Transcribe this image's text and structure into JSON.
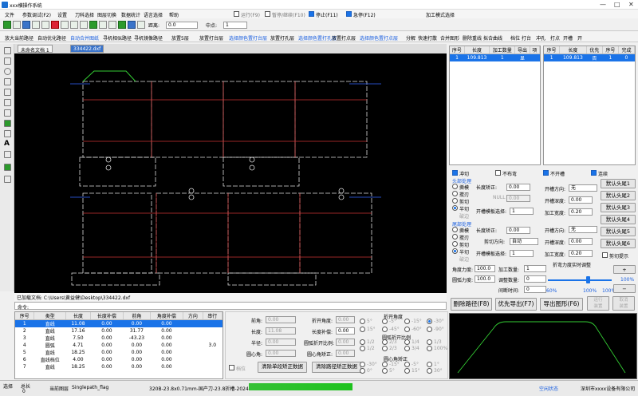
{
  "title": "xxx横操作系统",
  "menus": [
    "文件",
    "参数调试(F2)",
    "设置",
    "刀科选择",
    "图层切换",
    "数据统计",
    "语言选择",
    "帮助"
  ],
  "run_controls": {
    "run": "运行(F9)",
    "pause": "暂停/继续(F10)",
    "stop": "停止(F11)",
    "estop": "急停(F12)"
  },
  "mode_select": "加工模式选择",
  "toolbar": {
    "spacing_label": "距离:",
    "spacing_value": "0.0",
    "midpoint_label": "中点:",
    "midpoint_value": "1"
  },
  "toolbar2": [
    {
      "t": "放大当前路径",
      "b": false
    },
    {
      "t": "自动优化路径",
      "b": false
    },
    {
      "t": "自动合并图纸",
      "b": true
    },
    {
      "t": "寻机相似路径",
      "b": false
    },
    {
      "t": "寻机镜像路径",
      "b": false
    },
    {
      "t": "放置5层",
      "b": false
    },
    {
      "t": "放置打台层",
      "b": false
    },
    {
      "t": "选择颜色置打台层",
      "b": true
    },
    {
      "t": "放置打孔层",
      "b": false
    },
    {
      "t": "选择颜色置打孔层",
      "b": true
    },
    {
      "t": "放置打点层",
      "b": false
    },
    {
      "t": "选择颜色置打点层",
      "b": true
    },
    {
      "t": "分解",
      "b": false
    },
    {
      "t": "快速打散",
      "b": false
    },
    {
      "t": "合并图形",
      "b": false
    },
    {
      "t": "删除重线",
      "b": false
    },
    {
      "t": "拟合曲线",
      "b": false
    },
    {
      "t": "档位",
      "b": false
    },
    {
      "t": "打台",
      "b": false
    },
    {
      "t": "冲孔",
      "b": false
    },
    {
      "t": "打点",
      "b": false
    },
    {
      "t": "开槽",
      "b": false
    },
    {
      "t": "开",
      "b": false
    }
  ],
  "doc_tabs": [
    "未命名文档 1",
    "334422.dxf"
  ],
  "loaded_file": "已加载文档: C:\\Users\\黄益健\\Desktop\\334422.dxf",
  "command_label": "命令:",
  "table1": {
    "headers": [
      "序号",
      "长度",
      "加工数量",
      "导出",
      "项"
    ],
    "rows": [
      [
        "1",
        "109.813",
        "1",
        "显",
        ""
      ]
    ]
  },
  "table2": {
    "headers": [
      "序号",
      "长度",
      "优先",
      "序号",
      "完成"
    ],
    "rows": [
      [
        "1",
        "109.813",
        "否",
        "1",
        "0"
      ]
    ]
  },
  "panel": {
    "punch": "冲切",
    "no_edge": "不布弯",
    "no_slot": "不开槽",
    "chain": "连续",
    "head_group": "头部处理",
    "tail_group": "尾部处理",
    "opts_head": [
      "撕模",
      "搅刃",
      "剪切",
      "半切",
      "破边"
    ],
    "opts_tail": [
      "撕模",
      "搅刃",
      "剪切",
      "半切",
      "破边"
    ],
    "len_fix": "长度矫正:",
    "len_fix_val": "0.00",
    "null_label": "NULL",
    "null_val": "0.00",
    "slot_mode": "开槽模板选择:",
    "slot_mode_val": "1",
    "cut_dir": "剪切方向:",
    "cut_dir_val": "自动",
    "slot_dir": "开槽方向:",
    "slot_dir_val": "无",
    "slot_depth": "开槽深度:",
    "slot_depth_val": "0.00",
    "width": "加工宽度:",
    "width_val": "0.20",
    "default_heads": [
      "默认头尾1",
      "默认头尾2",
      "默认头尾3",
      "默认头尾4",
      "默认头尾5",
      "默认头尾6"
    ],
    "cut_tip": "剪切提示",
    "angle_label": "角度力度:",
    "angle_val": "100.0",
    "count_label": "加工数量:",
    "count_val": "1",
    "arc_label": "圆弧力度:",
    "arc_val": "100.0",
    "adjust_label": "调整数量:",
    "adjust_val": "0",
    "stretch_label": "间断时间:",
    "stretch_val": "0",
    "fold": "折弯力度实时调整",
    "pct_lo": "60%",
    "pct_mid": "100%",
    "pct_hi": "100%",
    "pct_max": "100%",
    "btn_del": "删除路径(F8)",
    "btn_priority": "优先导出(F7)",
    "btn_export": "导出图形(F6)",
    "btn_up": "运行\n装置",
    "btn_down": "取消\n装置"
  },
  "bottom_table": {
    "headers": [
      "序号",
      "类型",
      "长度",
      "长度补偿",
      "前角",
      "角度补偿",
      "方向",
      "串行"
    ],
    "rows": [
      [
        "1",
        "直线",
        "11.08",
        "0.00",
        "0.00",
        "0.00",
        "",
        ""
      ],
      [
        "2",
        "直线",
        "17.16",
        "0.00",
        "31.77",
        "0.00",
        "",
        ""
      ],
      [
        "3",
        "直线",
        "7.50",
        "0.00",
        "-43.23",
        "0.00",
        "",
        ""
      ],
      [
        "4",
        "圆弧",
        "4.71",
        "0.00",
        "0.00",
        "0.00",
        "",
        "3.0"
      ],
      [
        "5",
        "直线",
        "18.25",
        "0.00",
        "0.00",
        "0.00",
        "",
        ""
      ],
      [
        "6",
        "直线档位",
        "4.00",
        "0.00",
        "0.00",
        "0.00",
        "",
        ""
      ],
      [
        "7",
        "直线",
        "18.25",
        "0.00",
        "0.00",
        "0.00",
        "",
        ""
      ]
    ]
  },
  "bottom_mid": {
    "angle": "前角:",
    "angle_v": "0.00",
    "length": "长度:",
    "length_v": "11.08",
    "radius": "半径:",
    "radius_v": "0.00",
    "arc_ang": "圆心角:",
    "arc_ang_v": "0.00",
    "fold_ang": "折开角度:",
    "fold_ang_v": "0.00",
    "len_comp": "长度补偿:",
    "len_comp_v": "0.00",
    "arc_fold_ratio": "圆弧折开比例:",
    "arc_fold_ratio_v": "0.00",
    "arc_ang_fix": "圆心角矫正:",
    "arc_ang_fix_v": "0.00",
    "group1": "折开角度",
    "group2": "圆弧折开比例",
    "group3": "圆心角矫正",
    "deg_opts": [
      "5°",
      "-5°",
      "-15°",
      "-30°",
      "15°",
      "-45°",
      "-60°",
      "-90°",
      "1/2",
      "2/3",
      "1/4",
      "1/3",
      "1/2",
      "2/3",
      "3/4",
      "100%",
      "-30°",
      "-15°",
      "-5°",
      "1°",
      "0°",
      "5°",
      "15°",
      "30°"
    ],
    "pos": "档位",
    "btn_single": "清除单段矫正数据",
    "btn_path": "清除路径矫正数据"
  },
  "status": {
    "select": "选择",
    "total": "总长",
    "total_v": "0",
    "current": "当前图层",
    "layer": "Singlepath_flag",
    "info": "320B-23.8x0.71mm-国产刀-23.8折槽-2024.12.06",
    "space": "空闲状态",
    "company": "深圳市xxxx设备有限公司"
  }
}
